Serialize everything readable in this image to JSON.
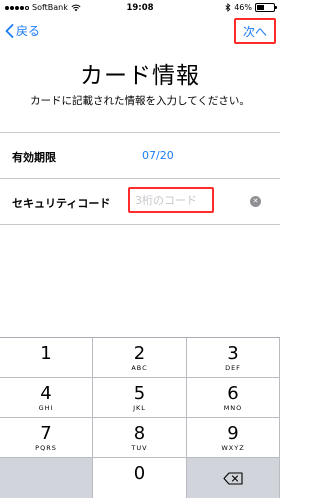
{
  "status_bar": {
    "carrier": "SoftBank",
    "time": "19:08",
    "battery_percent": "46%",
    "battery_level": 0.46,
    "signal_bars_filled": 4,
    "signal_bars_total": 5
  },
  "nav": {
    "back_label": "戻る",
    "next_label": "次へ"
  },
  "header": {
    "title": "カード情報",
    "subtitle": "カードに記載された情報を入力してください。"
  },
  "form": {
    "expiry": {
      "label": "有効期限",
      "value": "07/20"
    },
    "security_code": {
      "label": "セキュリティコード",
      "placeholder": "3桁のコード"
    }
  },
  "keypad": {
    "keys": [
      {
        "num": "1",
        "letters": ""
      },
      {
        "num": "2",
        "letters": "ABC"
      },
      {
        "num": "3",
        "letters": "DEF"
      },
      {
        "num": "4",
        "letters": "GHI"
      },
      {
        "num": "5",
        "letters": "JKL"
      },
      {
        "num": "6",
        "letters": "MNO"
      },
      {
        "num": "7",
        "letters": "PQRS"
      },
      {
        "num": "8",
        "letters": "TUV"
      },
      {
        "num": "9",
        "letters": "WXYZ"
      },
      {
        "num": "0",
        "letters": ""
      }
    ]
  },
  "colors": {
    "accent": "#1a7cf5",
    "highlight": "#ff2a2a"
  },
  "icons": {
    "back": "chevron-left-icon",
    "clear": "clear-icon",
    "delete": "backspace-icon",
    "wifi": "wifi-icon",
    "bluetooth": "bluetooth-icon",
    "battery": "battery-icon"
  }
}
